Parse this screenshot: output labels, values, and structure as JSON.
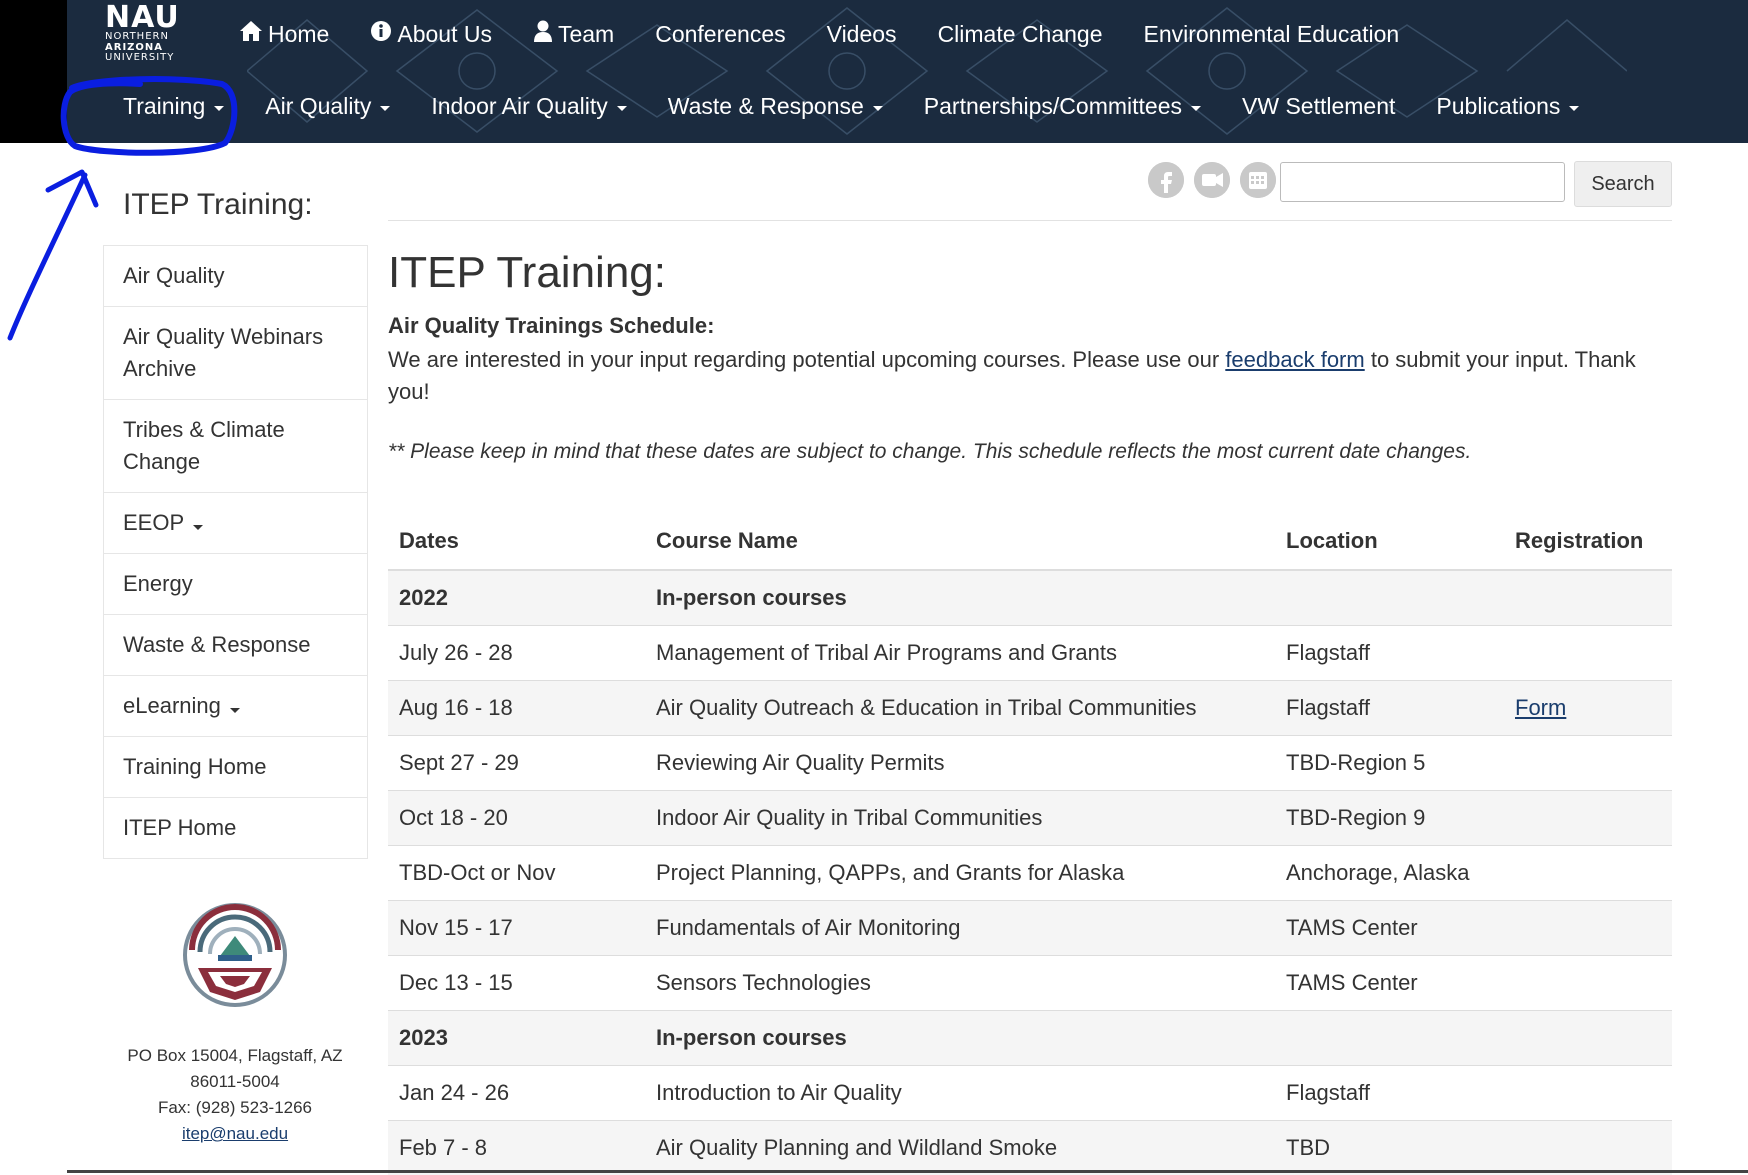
{
  "logo": {
    "nau": "NAU",
    "line1": "NORTHERN",
    "line2": "ARIZONA",
    "line3": "UNIVERSITY"
  },
  "topnav": [
    {
      "label": "Home",
      "icon": "home-icon"
    },
    {
      "label": "About Us",
      "icon": "info-icon"
    },
    {
      "label": "Team",
      "icon": "person-icon"
    },
    {
      "label": "Conferences"
    },
    {
      "label": "Videos"
    },
    {
      "label": "Climate Change"
    },
    {
      "label": "Environmental Education"
    }
  ],
  "mainnav": [
    {
      "label": "Training"
    },
    {
      "label": "Air Quality"
    },
    {
      "label": "Indoor Air Quality"
    },
    {
      "label": "Waste & Response"
    },
    {
      "label": "Partnerships/Committees"
    },
    {
      "label": "VW Settlement"
    },
    {
      "label": "Publications"
    }
  ],
  "sidebar": {
    "title": "ITEP Training:",
    "items": [
      {
        "label": "Air Quality"
      },
      {
        "label": "Air Quality Webinars Archive"
      },
      {
        "label": "Tribes & Climate Change"
      },
      {
        "label": "EEOP"
      },
      {
        "label": "Energy"
      },
      {
        "label": "Waste & Response"
      },
      {
        "label": "eLearning"
      },
      {
        "label": "Training Home"
      },
      {
        "label": "ITEP Home"
      }
    ],
    "address": {
      "line1": "PO Box 15004, Flagstaff, AZ",
      "line2": "86011-5004",
      "fax": "Fax: (928) 523-1266",
      "email": "itep@nau.edu"
    }
  },
  "search": {
    "button": "Search",
    "value": ""
  },
  "social_icons": [
    "facebook-icon",
    "video-icon",
    "calendar-icon"
  ],
  "main": {
    "title": "ITEP Training:",
    "subheading": "Air Quality Trainings Schedule:",
    "intro_before": "We are interested in your input regarding potential upcoming courses. Please use our ",
    "intro_link": "feedback form",
    "intro_after": " to submit your input. Thank you!",
    "note": "** Please keep in mind that these dates are subject to change. This schedule reflects the most current date changes."
  },
  "table": {
    "headers": [
      "Dates",
      "Course Name",
      "Location",
      "Registration"
    ],
    "rows": [
      {
        "type": "group",
        "dates": "2022",
        "course": "In-person courses",
        "location": "",
        "registration": ""
      },
      {
        "dates": "July 26 - 28",
        "course": "Management of Tribal Air Programs and Grants",
        "location": "Flagstaff",
        "registration": ""
      },
      {
        "dates": "Aug 16 - 18",
        "course": "Air Quality Outreach & Education in Tribal Communities",
        "location": "Flagstaff",
        "registration": "Form"
      },
      {
        "dates": "Sept 27 - 29",
        "course": "Reviewing Air Quality Permits",
        "location": "TBD-Region 5",
        "registration": ""
      },
      {
        "dates": "Oct 18 - 20",
        "course": "Indoor Air Quality in Tribal Communities",
        "location": "TBD-Region 9",
        "registration": ""
      },
      {
        "dates": "TBD-Oct or Nov",
        "course": "Project Planning, QAPPs, and Grants for Alaska",
        "location": "Anchorage, Alaska",
        "registration": ""
      },
      {
        "dates": "Nov 15 - 17",
        "course": "Fundamentals of Air Monitoring",
        "location": "TAMS Center",
        "registration": ""
      },
      {
        "dates": "Dec 13 - 15",
        "course": "Sensors Technologies",
        "location": "TAMS Center",
        "registration": ""
      },
      {
        "type": "group",
        "dates": "2023",
        "course": "In-person courses",
        "location": "",
        "registration": ""
      },
      {
        "dates": "Jan 24 - 26",
        "course": "Introduction to Air Quality",
        "location": "Flagstaff",
        "registration": ""
      },
      {
        "dates": "Feb 7 - 8",
        "course": "Air Quality Planning and Wildland Smoke",
        "location": "TBD",
        "registration": ""
      }
    ]
  },
  "colors": {
    "header_bg": "#1b2b3f",
    "link": "#1a3d6d",
    "annotation": "#0a1ee0"
  }
}
